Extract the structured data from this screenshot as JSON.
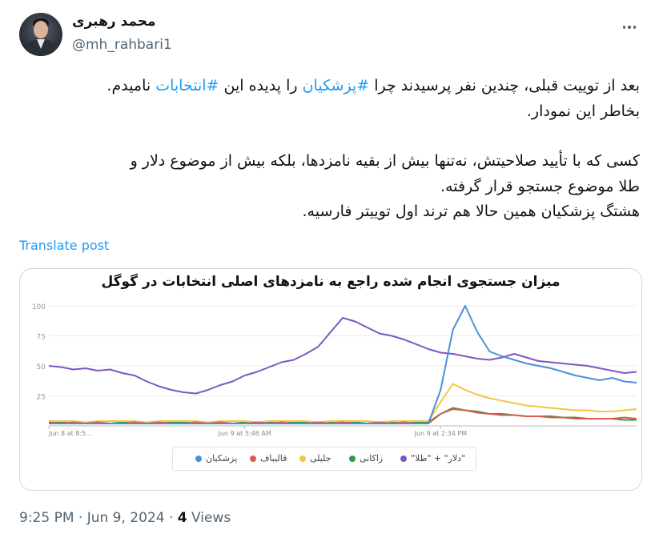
{
  "author": {
    "display_name": "محمد رهبری",
    "handle": "@mh_rahbari1"
  },
  "tweet": {
    "lines": [
      {
        "pre": "بعد از توییت قبلی، چندین نفر پرسیدند چرا ",
        "tag1": "#پزشکیان",
        "mid": " را پدیده این ",
        "tag2": "#انتخابات",
        "post": " نامیدم."
      },
      {
        "text": "بخاطر این نمودار."
      },
      {
        "text": "کسی که با تأیید صلاحیتش، نه‌تنها بیش از بقیه نامزدها، بلکه بیش از موضوع دلار و"
      },
      {
        "text": "طلا موضوع جستجو قرار گرفته."
      },
      {
        "text": "هشتگ پزشکیان همین حالا هم ترند اول توییتر فارسیه."
      }
    ],
    "translate_label": "Translate post"
  },
  "meta": {
    "time": "9:25 PM",
    "date": "Jun 9, 2024",
    "views_count": "4",
    "views_label": "Views"
  },
  "chart_data": {
    "type": "line",
    "title": "میزان جستجوی انجام شده راجع به نامزدهای اصلی انتخابات در گوگل",
    "ylim": [
      0,
      100
    ],
    "yticks": [
      0,
      25,
      50,
      75,
      100
    ],
    "ytick_labels": [
      "",
      "25",
      "50",
      "75",
      "100"
    ],
    "xlim": [
      0,
      48
    ],
    "xticks": [
      {
        "x": 0,
        "label": "Jun 8 at 8:5..."
      },
      {
        "x": 16,
        "label": "Jun 9 at 5:46 AM"
      },
      {
        "x": 32,
        "label": "Jun 9 at 2:34 PM"
      }
    ],
    "grid": true,
    "legend_position": "bottom",
    "series": [
      {
        "name": "\"دلار\" + \"طلا\"",
        "color": "#7e57c2",
        "values": [
          50,
          49,
          47,
          48,
          46,
          47,
          44,
          42,
          37,
          33,
          30,
          28,
          27,
          30,
          34,
          37,
          42,
          45,
          49,
          53,
          55,
          60,
          66,
          78,
          90,
          87,
          82,
          77,
          75,
          72,
          68,
          64,
          61,
          60,
          58,
          56,
          55,
          57,
          60,
          57,
          54,
          53,
          52,
          51,
          50,
          48,
          46,
          44,
          45
        ]
      },
      {
        "name": "زاکانی",
        "color": "#2e9a4c",
        "values": [
          3,
          3,
          2,
          3,
          3,
          2,
          3,
          3,
          3,
          2,
          3,
          3,
          2,
          3,
          3,
          2,
          3,
          3,
          3,
          2,
          3,
          3,
          2,
          3,
          3,
          3,
          2,
          3,
          3,
          2,
          3,
          3,
          10,
          15,
          13,
          12,
          10,
          10,
          9,
          8,
          8,
          8,
          7,
          7,
          6,
          6,
          6,
          5,
          5
        ]
      },
      {
        "name": "جلیلی",
        "color": "#f4c542",
        "values": [
          4,
          4,
          4,
          3,
          4,
          4,
          4,
          4,
          3,
          4,
          4,
          4,
          4,
          3,
          4,
          4,
          4,
          3,
          4,
          4,
          4,
          4,
          3,
          4,
          4,
          4,
          4,
          3,
          4,
          4,
          4,
          4,
          20,
          35,
          30,
          26,
          23,
          21,
          19,
          17,
          16,
          15,
          14,
          13,
          13,
          12,
          12,
          13,
          14
        ]
      },
      {
        "name": "قالیباف",
        "color": "#e05a4f",
        "values": [
          3,
          2,
          3,
          2,
          3,
          2,
          2,
          3,
          2,
          3,
          2,
          2,
          3,
          2,
          3,
          2,
          2,
          3,
          2,
          3,
          2,
          2,
          3,
          2,
          3,
          2,
          2,
          3,
          2,
          3,
          2,
          2,
          10,
          14,
          13,
          11,
          10,
          9,
          9,
          8,
          8,
          7,
          7,
          6,
          6,
          6,
          6,
          7,
          6
        ]
      },
      {
        "name": "پزشکیان",
        "color": "#4a90d9",
        "values": [
          2,
          2,
          2,
          2,
          2,
          2,
          2,
          2,
          2,
          2,
          2,
          2,
          2,
          2,
          2,
          2,
          2,
          2,
          2,
          2,
          2,
          2,
          2,
          2,
          2,
          2,
          2,
          2,
          2,
          2,
          2,
          2,
          30,
          80,
          100,
          78,
          62,
          58,
          55,
          52,
          50,
          48,
          45,
          42,
          40,
          38,
          40,
          37,
          36
        ]
      }
    ]
  }
}
